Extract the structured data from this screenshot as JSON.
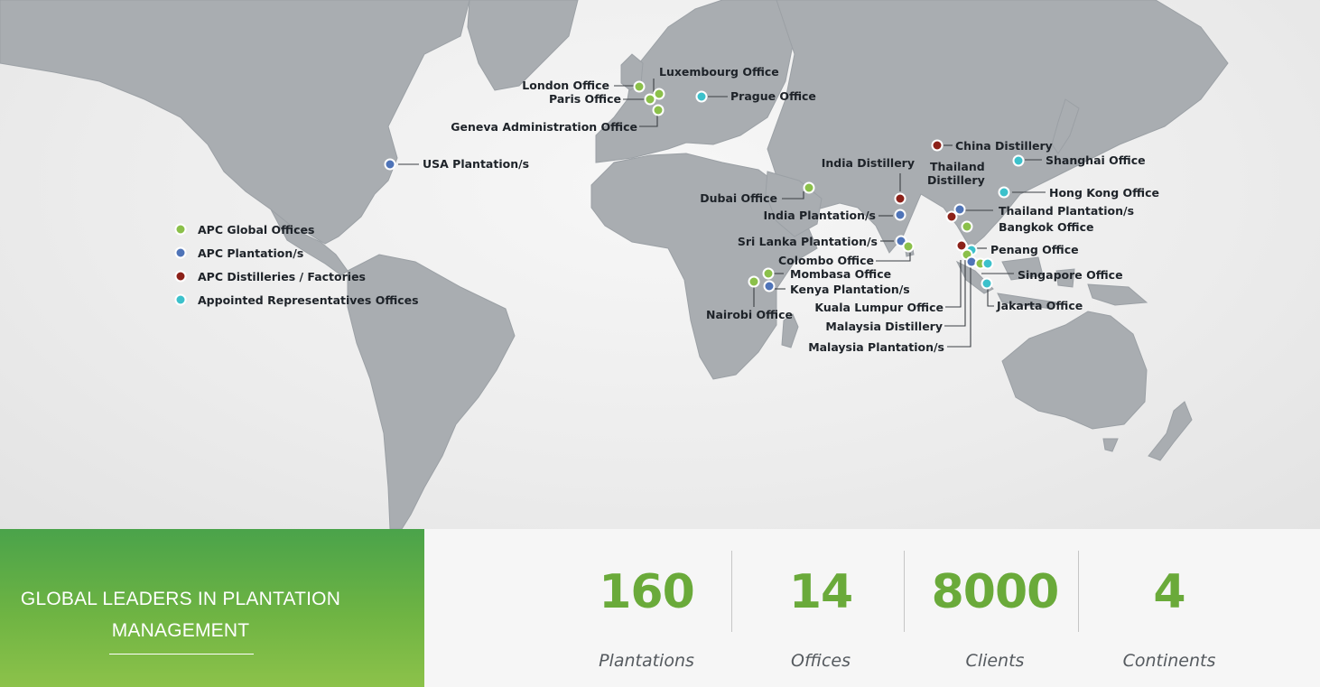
{
  "map": {
    "legend": [
      {
        "label": "APC Global Offices",
        "color": "#8bc04a"
      },
      {
        "label": "APC Plantation/s",
        "color": "#4f74b8"
      },
      {
        "label": "APC Distilleries / Factories",
        "color": "#8c2119"
      },
      {
        "label": "Appointed Representatives Offices",
        "color": "#3cc1cb"
      }
    ],
    "locations": {
      "london": "London Office",
      "paris": "Paris Office",
      "luxembourg": "Luxembourg Office",
      "prague": "Prague Office",
      "geneva": "Geneva Administration Office",
      "usa": "USA Plantation/s",
      "china_distillery": "China Distillery",
      "shanghai": "Shanghai Office",
      "india_distillery": "India Distillery",
      "thailand_distillery_1": "Thailand",
      "thailand_distillery_2": "Distillery",
      "dubai": "Dubai Office",
      "hong_kong": "Hong Kong Office",
      "india_plantation": "India Plantation/s",
      "thailand_plantation": "Thailand Plantation/s",
      "bangkok": "Bangkok Office",
      "sri_lanka": "Sri Lanka Plantation/s",
      "colombo": "Colombo Office",
      "penang": "Penang Office",
      "mombasa": "Mombasa Office",
      "kenya": "Kenya Plantation/s",
      "singapore": "Singapore Office",
      "nairobi": "Nairobi Office",
      "kuala_lumpur": "Kuala Lumpur  Office",
      "jakarta": "Jakarta Office",
      "malaysia_distillery": "Malaysia Distillery",
      "malaysia_plantation": "Malaysia Plantation/s"
    }
  },
  "tagline": {
    "line1": "GLOBAL LEADERS IN PLANTATION",
    "line2": "MANAGEMENT"
  },
  "stats": [
    {
      "value": "160",
      "label": "Plantations"
    },
    {
      "value": "14",
      "label": "Offices"
    },
    {
      "value": "8000",
      "label": "Clients"
    },
    {
      "value": "4",
      "label": "Continents"
    }
  ]
}
